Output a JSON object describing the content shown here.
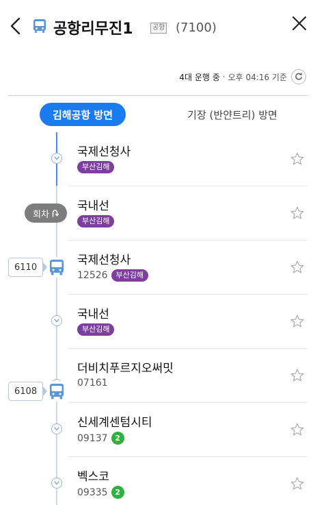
{
  "header": {
    "route_name": "공항리무진1",
    "type_badge": "공항",
    "route_number": "(7100)"
  },
  "status": {
    "running": "4대 운행 중",
    "separator": "·",
    "time": "오후 04:16 기준"
  },
  "tabs": [
    {
      "label": "김해공항 방면",
      "active": true
    },
    {
      "label": "기장 (반얀트리) 방면",
      "active": false
    }
  ],
  "turnaround": {
    "label": "회차"
  },
  "stops": [
    {
      "name": "국제선청사",
      "code": "",
      "region": "부산김해",
      "metro": ""
    },
    {
      "name": "국내선",
      "code": "",
      "region": "부산김해",
      "metro": ""
    },
    {
      "name": "국제선청사",
      "code": "12526",
      "region": "부산김해",
      "metro": ""
    },
    {
      "name": "국내선",
      "code": "",
      "region": "부산김해",
      "metro": ""
    },
    {
      "name": "더비치푸르지오써밋",
      "code": "07161",
      "region": "",
      "metro": ""
    },
    {
      "name": "신세계센텀시티",
      "code": "09137",
      "region": "",
      "metro": "2"
    },
    {
      "name": "벡스코",
      "code": "09335",
      "region": "",
      "metro": "2"
    }
  ],
  "buses": [
    {
      "plate": "6110"
    },
    {
      "plate": "6108"
    }
  ],
  "colors": {
    "accent": "#1b7cf0",
    "bus_icon": "#5a95d6",
    "region_badge": "#7c3fa0",
    "metro_line2": "#2db140",
    "turnaround": "#7d7d7d"
  }
}
